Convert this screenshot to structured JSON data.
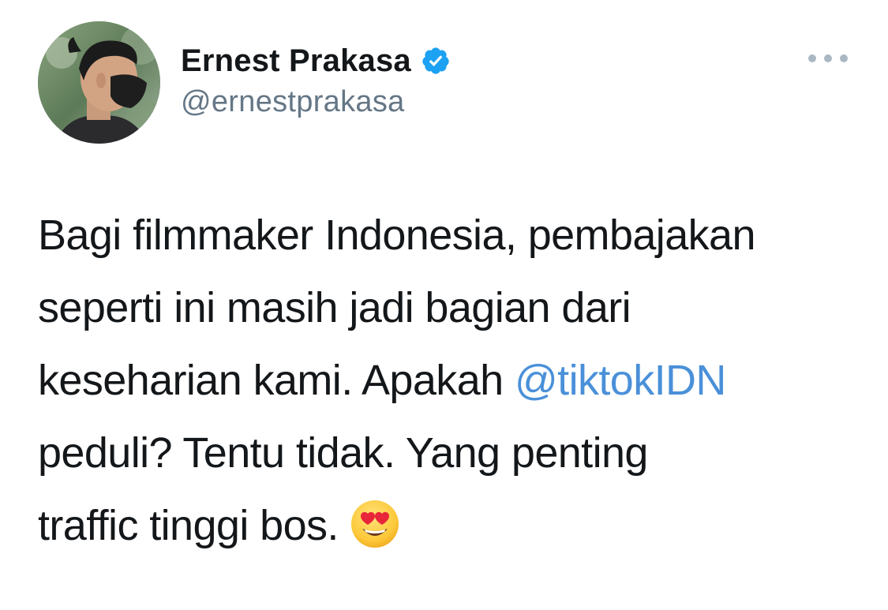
{
  "user": {
    "display_name": "Ernest Prakasa",
    "handle": "@ernestprakasa",
    "avatar_icon": "profile-photo",
    "verified_icon": "verified-badge-icon"
  },
  "tweet": {
    "line1": "Bagi filmmaker Indonesia, pembajakan",
    "line2": "seperti ini masih jadi bagian dari",
    "line3_before": "keseharian kami. Apakah ",
    "mention": "@tiktokIDN",
    "line4": "peduli? Tentu tidak. Yang penting",
    "line5": "traffic tinggi bos.",
    "emoji_icon": "heart-eyes-emoji-icon"
  },
  "colors": {
    "text": "#14171a",
    "secondary": "#657786",
    "mention": "#4a90d9",
    "verified": "#1da1f2",
    "more_dots": "#aab8c2"
  }
}
